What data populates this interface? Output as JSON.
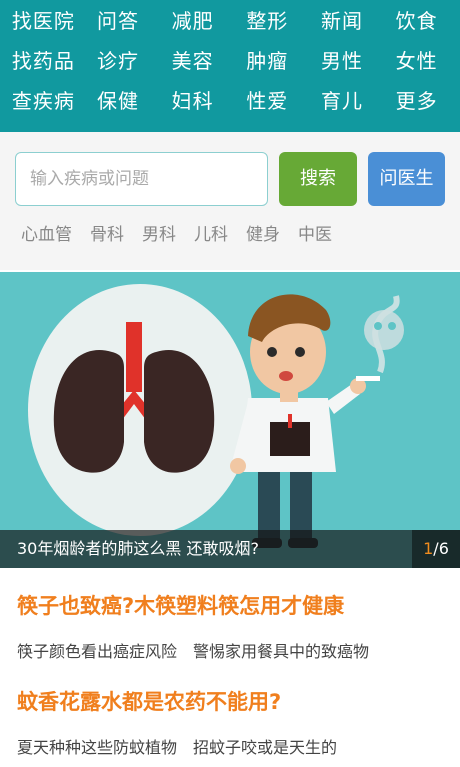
{
  "nav": {
    "items": [
      "找医院",
      "问答",
      "减肥",
      "整形",
      "新闻",
      "饮食",
      "找药品",
      "诊疗",
      "美容",
      "肿瘤",
      "男性",
      "女性",
      "查疾病",
      "保健",
      "妇科",
      "性爱",
      "育儿",
      "更多"
    ]
  },
  "search": {
    "placeholder": "输入疾病或问题",
    "search_label": "搜索",
    "ask_label": "问医生",
    "tags": [
      "心血管",
      "骨科",
      "男科",
      "儿科",
      "健身",
      "中医"
    ]
  },
  "banner": {
    "caption": "30年烟龄者的肺这么黑 还敢吸烟?",
    "page_current": "1",
    "page_total": "/6"
  },
  "articles": [
    {
      "title": "筷子也致癌?木筷塑料筷怎用才健康",
      "links": [
        "筷子颜色看出癌症风险",
        "警惕家用餐具中的致癌物"
      ]
    },
    {
      "title": "蚊香花露水都是农药不能用?",
      "links": [
        "夏天种种这些防蚊植物",
        "招蚊子咬或是天生的"
      ]
    }
  ],
  "colors": {
    "nav_bg": "#11999f",
    "search_btn": "#67a936",
    "ask_btn": "#4a8fd6",
    "article_title": "#f07f1e"
  }
}
